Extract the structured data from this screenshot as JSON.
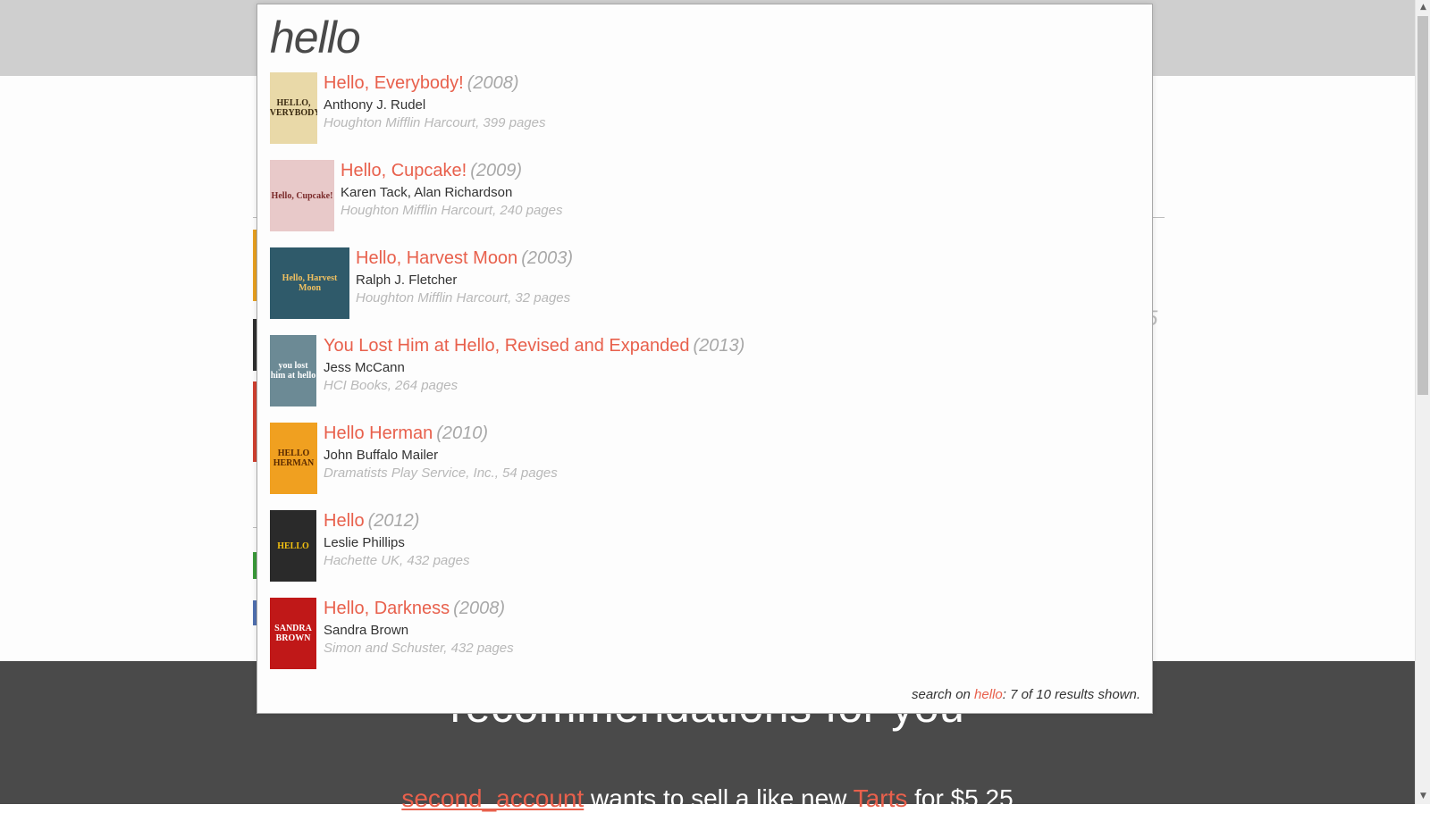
{
  "search": {
    "query": "hello"
  },
  "results": [
    {
      "title": "Hello, Everybody!",
      "year": "(2008)",
      "author": "Anthony J. Rudel",
      "publisher": "Houghton Mifflin Harcourt, 399 pages",
      "cover_text": "HELLO, EVERYBODY!",
      "cover_colors": {
        "bg": "#e9d9a8",
        "fg": "#3a2a10"
      }
    },
    {
      "title": "Hello, Cupcake!",
      "year": "(2009)",
      "author": "Karen Tack, Alan Richardson",
      "publisher": "Houghton Mifflin Harcourt, 240 pages",
      "cover_text": "Hello, Cupcake!",
      "cover_colors": {
        "bg": "#e8c9c9",
        "fg": "#7a2a2a"
      }
    },
    {
      "title": "Hello, Harvest Moon",
      "year": "(2003)",
      "author": "Ralph J. Fletcher",
      "publisher": "Houghton Mifflin Harcourt, 32 pages",
      "cover_text": "Hello, Harvest Moon",
      "cover_colors": {
        "bg": "#2f5a6a",
        "fg": "#f0c060"
      }
    },
    {
      "title": "You Lost Him at Hello, Revised and Expanded",
      "year": "(2013)",
      "author": "Jess McCann",
      "publisher": "HCI Books, 264 pages",
      "cover_text": "you lost him at hello",
      "cover_colors": {
        "bg": "#6c8a95",
        "fg": "#ffffff"
      }
    },
    {
      "title": "Hello Herman",
      "year": "(2010)",
      "author": "John Buffalo Mailer",
      "publisher": "Dramatists Play Service, Inc., 54 pages",
      "cover_text": "HELLO HERMAN",
      "cover_colors": {
        "bg": "#f0a020",
        "fg": "#5a2a00"
      }
    },
    {
      "title": "Hello",
      "year": "(2012)",
      "author": "Leslie Phillips",
      "publisher": "Hachette UK, 432 pages",
      "cover_text": "HELLO",
      "cover_colors": {
        "bg": "#2a2a2a",
        "fg": "#f2c010"
      }
    },
    {
      "title": "Hello, Darkness",
      "year": "(2008)",
      "author": "Sandra Brown",
      "publisher": "Simon and Schuster, 432 pages",
      "cover_text": "SANDRA BROWN",
      "cover_colors": {
        "bg": "#c01818",
        "fg": "#ffffff"
      }
    }
  ],
  "footer": {
    "prefix": "search on ",
    "query": "hello",
    "suffix": ": 7 of 10 results shown."
  },
  "background": {
    "heading": "recommendations for you",
    "line_user": "second_account",
    "line_mid": " wants to sell a like new ",
    "line_book": "Tarts",
    "line_price": " for $5.25"
  },
  "colors": {
    "accent": "#e8604c",
    "year_gray": "#a8a8a8",
    "publisher_gray": "#b8b8b8",
    "dark_band": "#4a4a4a",
    "top_band": "#cfcfcf"
  },
  "icons": {
    "scroll_up": "up-arrow-icon",
    "scroll_down": "down-arrow-icon"
  }
}
